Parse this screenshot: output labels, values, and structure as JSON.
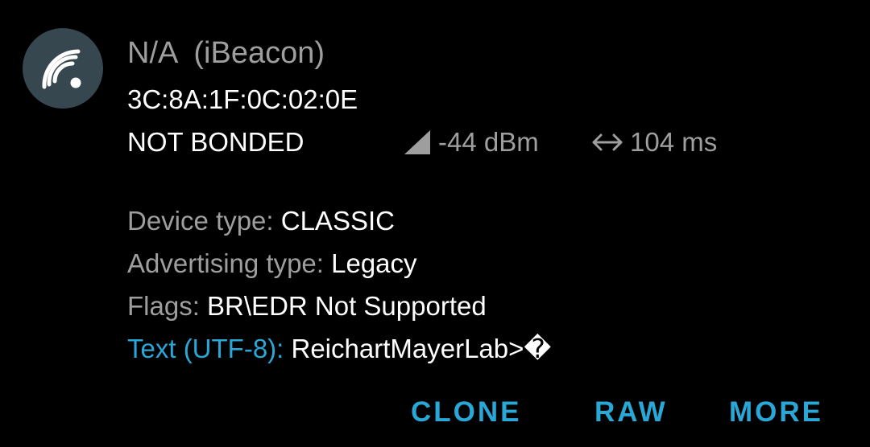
{
  "device": {
    "name": "N/A",
    "beacon_type": "(iBeacon)",
    "mac": "3C:8A:1F:0C:02:0E",
    "bond_state": "NOT BONDED",
    "rssi": "-44 dBm",
    "interval": "104 ms",
    "icon": "signal-broadcast-icon"
  },
  "details": {
    "device_type_label": "Device type: ",
    "device_type_value": "CLASSIC",
    "adv_type_label": "Advertising type: ",
    "adv_type_value": "Legacy",
    "flags_label": "Flags: ",
    "flags_value": "BR\\EDR Not Supported",
    "text_label": "Text (UTF-8): ",
    "text_value": "ReichartMayerLab>�"
  },
  "actions": {
    "clone": "CLONE",
    "raw": "RAW",
    "more": "MORE"
  },
  "colors": {
    "background": "#000000",
    "avatar": "#37474f",
    "accent": "#29a7d6",
    "secondary_text": "#9e9e9e",
    "primary_text": "#ffffff"
  }
}
